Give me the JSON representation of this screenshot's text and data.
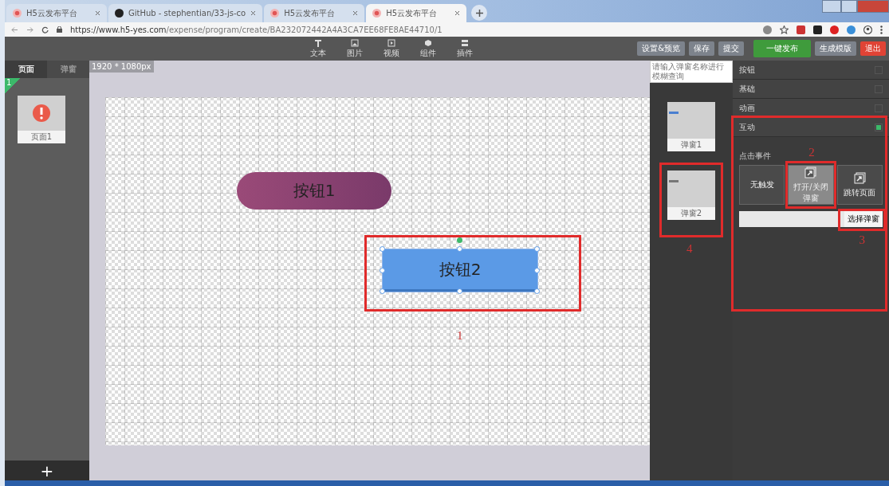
{
  "browser": {
    "tabs": [
      {
        "title": "H5云发布平台",
        "selected": false
      },
      {
        "title": "GitHub - stephentian/33-js-co",
        "selected": false
      },
      {
        "title": "H5云发布平台",
        "selected": false
      },
      {
        "title": "H5云发布平台",
        "selected": true
      }
    ],
    "url_host": "https://www.h5-yes.com",
    "url_path": "/expense/program/create/BA232072442A4A3CA7EE68FE8AE44710/1"
  },
  "toolbar": {
    "tools": [
      {
        "label": "文本"
      },
      {
        "label": "图片"
      },
      {
        "label": "视频"
      },
      {
        "label": "组件"
      },
      {
        "label": "插件"
      }
    ],
    "actions": [
      {
        "label": "设置&预览",
        "kind": "grey"
      },
      {
        "label": "保存",
        "kind": "grey"
      },
      {
        "label": "提交",
        "kind": "grey"
      }
    ],
    "publish": [
      {
        "label": "一键发布",
        "kind": "green"
      },
      {
        "label": "生成模版",
        "kind": "grey"
      },
      {
        "label": "退出",
        "kind": "red"
      }
    ]
  },
  "left_panel": {
    "tabs": [
      {
        "label": "页面",
        "selected": true
      },
      {
        "label": "弹窗",
        "selected": false
      }
    ],
    "pages": [
      {
        "badge": "1",
        "label": "页面1",
        "selected": true
      }
    ],
    "add": "+"
  },
  "canvas": {
    "size": "1920 * 1080px",
    "elements": [
      {
        "label": "按钮1",
        "kind": "pill",
        "selected": false
      },
      {
        "label": "按钮2",
        "kind": "rect",
        "selected": true,
        "callout": "1"
      }
    ]
  },
  "popups": {
    "search": {
      "placeholder": "请输入弹窗名称进行模糊查询"
    },
    "items": [
      {
        "label": "弹窗1"
      },
      {
        "label": "弹窗2",
        "callout": "4"
      }
    ]
  },
  "properties": {
    "sections": [
      {
        "label": "按钮",
        "checked": false,
        "highlighted": false
      },
      {
        "label": "基础",
        "checked": false,
        "highlighted": false
      },
      {
        "label": "动画",
        "checked": false,
        "highlighted": false
      },
      {
        "label": "互动",
        "checked": true,
        "highlighted": true
      }
    ],
    "event_label": "点击事件",
    "options": [
      {
        "label": "无触发",
        "icon": false,
        "selected": false
      },
      {
        "label": "打开/关闭弹窗",
        "icon": true,
        "selected": true,
        "callout": "2"
      },
      {
        "label": "跳转页面",
        "icon": true,
        "selected": false
      }
    ],
    "choose_button": {
      "label": "选择弹窗",
      "callout": "3"
    }
  }
}
